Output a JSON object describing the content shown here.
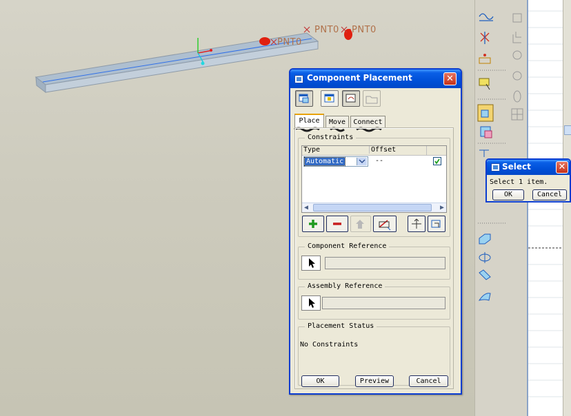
{
  "viewport": {
    "datum_points": [
      {
        "label": "PNT0"
      },
      {
        "label": "PNT0"
      },
      {
        "label": "PNT0"
      }
    ]
  },
  "dialog": {
    "title": "Component Placement",
    "close_glyph": "✕",
    "tabs": [
      {
        "label": "Place",
        "active": true
      },
      {
        "label": "Move",
        "active": false
      },
      {
        "label": "Connect",
        "active": false
      }
    ],
    "constraints": {
      "legend": "Constraints",
      "col_type": "Type",
      "col_offset": "Offset",
      "row_type_value": "Automatic",
      "row_offset_value": "--",
      "row_checked": true
    },
    "component_reference_label": "Component Reference",
    "assembly_reference_label": "Assembly Reference",
    "placement_status_label": "Placement Status",
    "placement_status_text": "No Constraints",
    "ok_label": "OK",
    "preview_label": "Preview",
    "cancel_label": "Cancel"
  },
  "select_dialog": {
    "title": "Select",
    "close_glyph": "✕",
    "message": "Select 1 item.",
    "ok_label": "OK",
    "cancel_label": "Cancel"
  },
  "colors": {
    "title_blue": "#0050d8",
    "close_red": "#c6321a",
    "datum_orange": "#b0714a",
    "add_green": "#1f9a1f",
    "remove_red": "#c81e1e"
  },
  "icons": {
    "add": "plus-icon",
    "remove": "minus-icon",
    "cursor": "arrow-cursor-icon"
  }
}
